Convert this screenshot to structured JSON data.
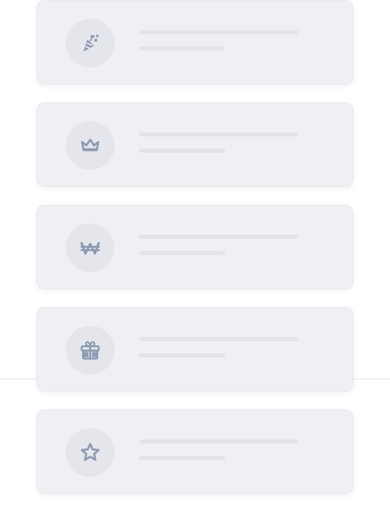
{
  "cards": [
    {
      "icon": "party-popper-icon"
    },
    {
      "icon": "crown-icon"
    },
    {
      "icon": "won-currency-icon"
    },
    {
      "icon": "gift-icon"
    },
    {
      "icon": "star-icon"
    }
  ],
  "colors": {
    "card_background": "#eef0f4",
    "icon_circle_background": "#e4e6eb",
    "icon_color": "#8e9bb3",
    "placeholder_line": "#e2e4e9",
    "divider": "#e6e8ec",
    "page_background": "#ffffff"
  }
}
